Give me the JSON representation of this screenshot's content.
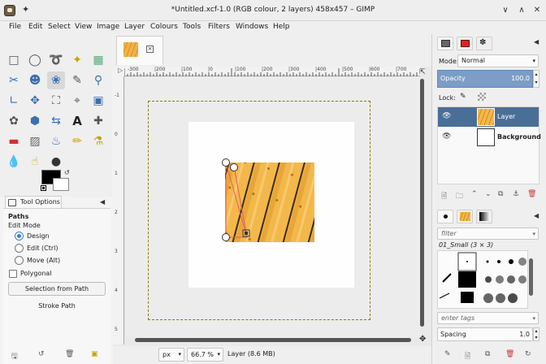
{
  "window": {
    "title": "*Untitled.xcf-1.0 (RGB colour, 2 layers) 458x457 – GIMP",
    "pin_glyph": "✦",
    "minimize_glyph": "∨",
    "maximize_glyph": "∧",
    "close_glyph": "✕"
  },
  "menubar": {
    "items": [
      "File",
      "Edit",
      "Select",
      "View",
      "Image",
      "Layer",
      "Colours",
      "Tools",
      "Filters",
      "Windows",
      "Help"
    ]
  },
  "toolbox": {
    "tools": [
      {
        "name": "rect-select-tool-icon"
      },
      {
        "name": "ellipse-select-tool-icon"
      },
      {
        "name": "free-select-tool-icon"
      },
      {
        "name": "fuzzy-select-tool-icon"
      },
      {
        "name": "select-by-color-tool-icon"
      },
      {
        "name": "scissors-tool-icon"
      },
      {
        "name": "foreground-select-tool-icon"
      },
      {
        "name": "paths-tool-icon",
        "active": true
      },
      {
        "name": "color-picker-tool-icon"
      },
      {
        "name": "zoom-tool-icon"
      },
      {
        "name": "measure-tool-icon"
      },
      {
        "name": "move-tool-icon"
      },
      {
        "name": "align-tool-icon"
      },
      {
        "name": "crop-tool-icon"
      },
      {
        "name": "unified-transform-tool-icon"
      },
      {
        "name": "warp-transform-tool-icon"
      },
      {
        "name": "cage-transform-tool-icon"
      },
      {
        "name": "flip-tool-icon"
      },
      {
        "name": "text-tool-icon"
      },
      {
        "name": "heal-tool-icon"
      },
      {
        "name": "eraser-tool-icon"
      },
      {
        "name": "blend-tool-icon"
      },
      {
        "name": "bucket-fill-tool-icon"
      },
      {
        "name": "pencil-tool-icon"
      },
      {
        "name": "clone-tool-icon"
      },
      {
        "name": "blur-tool-icon"
      },
      {
        "name": "smudge-tool-icon"
      },
      {
        "name": "dodge-burn-tool-icon"
      }
    ],
    "fg_color": "#000000",
    "bg_color": "#ffffff"
  },
  "tool_options": {
    "tab_label": "Tool Options",
    "section": "Paths",
    "edit_mode_label": "Edit Mode",
    "modes": [
      {
        "label": "Design",
        "selected": true
      },
      {
        "label": "Edit (Ctrl)",
        "selected": false
      },
      {
        "label": "Move (Alt)",
        "selected": false
      }
    ],
    "polygonal_label": "Polygonal",
    "selection_button": "Selection from Path",
    "stroke_button": "Stroke Path"
  },
  "ruler": {
    "top_ticks": [
      "-300",
      "|200",
      "|100",
      "|0",
      "|100",
      "|200",
      "|300",
      "|400",
      "|500",
      "|600",
      "|700"
    ],
    "left_ticks": [
      "-1",
      "0",
      "1",
      "2",
      "3",
      "4",
      "5"
    ]
  },
  "statusbar": {
    "unit": "px",
    "zoom": "66.7 %",
    "layer_info": "Layer (8.6 MB)"
  },
  "layers_panel": {
    "mode_label": "Mode:",
    "mode_value": "Normal",
    "opacity_label": "Opacity",
    "opacity_value": "100.0",
    "opacity": 1.0,
    "lock_label": "Lock:",
    "layers": [
      {
        "name": "Layer",
        "visible": true,
        "selected": true
      },
      {
        "name": "Background",
        "visible": true,
        "selected": false
      }
    ]
  },
  "brushes_panel": {
    "filter_placeholder": "filter",
    "brush_name": "01_Small (3 × 3)",
    "tags_placeholder": "enter tags",
    "spacing_label": "Spacing",
    "spacing_value": "1.0"
  },
  "colors": {
    "accent": "#4a6f97",
    "wood_light": "#f3b84a",
    "wood_dark": "#c98416"
  }
}
